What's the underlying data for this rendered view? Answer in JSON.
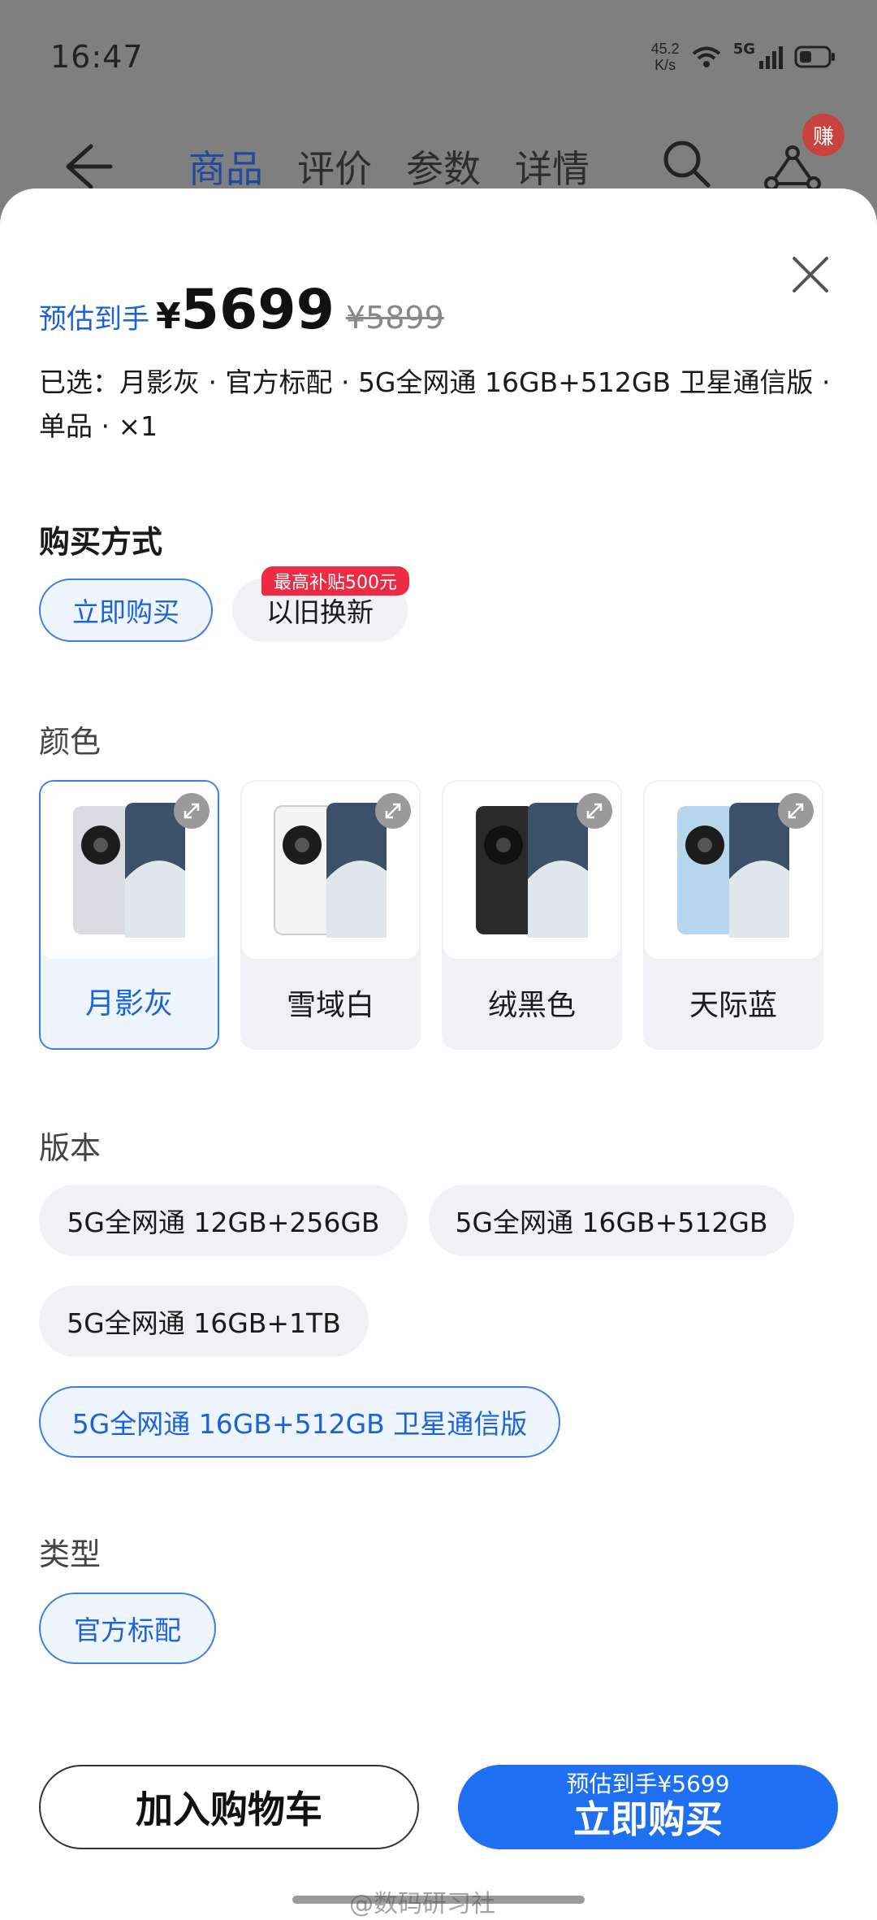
{
  "status_bar": {
    "time": "16:47",
    "net_speed_value": "45.2",
    "net_speed_unit": "K/s",
    "signal": "5G"
  },
  "nav": {
    "tabs": [
      "商品",
      "评价",
      "参数",
      "详情"
    ],
    "active_tab": 0,
    "earn_badge": "赚"
  },
  "sheet": {
    "price_prefix": "预估到手",
    "currency": "¥",
    "price": "5699",
    "original_price": "¥5899",
    "selected_text": "已选：月影灰 · 官方标配 · 5G全网通 16GB+512GB 卫星通信版 · 单品 · ×1",
    "purchase": {
      "title": "购买方式",
      "options": [
        "立即购买",
        "以旧换新"
      ],
      "selected": 0,
      "badge": "最高补贴500元"
    },
    "color": {
      "title": "颜色",
      "options": [
        "月影灰",
        "雪域白",
        "绒黑色",
        "天际蓝"
      ],
      "selected": 0,
      "swatches": [
        "#d9dde3",
        "#f4f4f4",
        "#2a2a2a",
        "#b6d6ee"
      ]
    },
    "version": {
      "title": "版本",
      "options": [
        "5G全网通 12GB+256GB",
        "5G全网通 16GB+512GB",
        "5G全网通 16GB+1TB",
        "5G全网通 16GB+512GB 卫星通信版"
      ],
      "selected": 3
    },
    "type": {
      "title": "类型",
      "options": [
        "官方标配"
      ],
      "selected": 0
    }
  },
  "actions": {
    "add_cart": "加入购物车",
    "buy_sub": "预估到手¥5699",
    "buy_main": "立即购买"
  },
  "watermark": "@数码研习社",
  "colors": {
    "accent": "#1e6ff1",
    "accent_text": "#1b63d6",
    "badge": "#ee2b44"
  }
}
